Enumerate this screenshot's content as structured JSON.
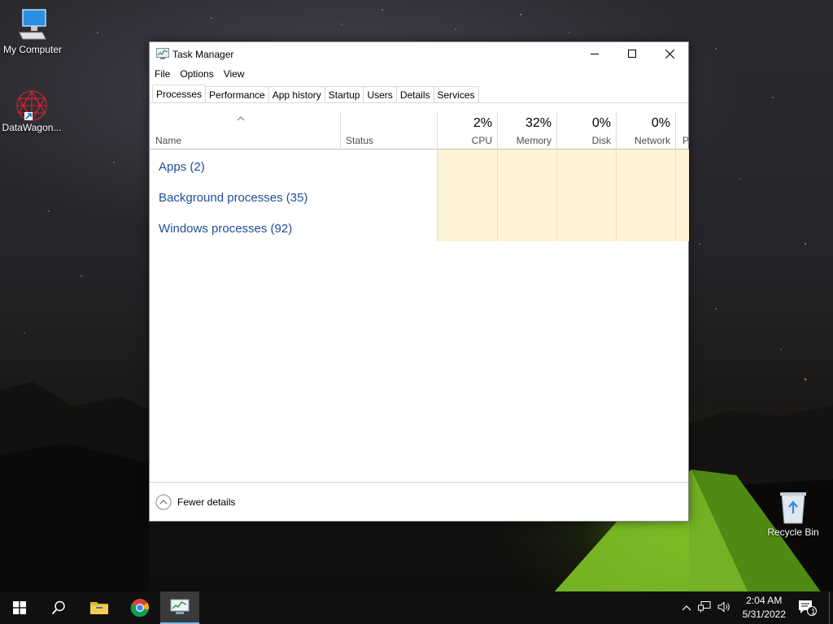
{
  "desktop": {
    "icons": [
      {
        "label": "My Computer"
      },
      {
        "label": "DataWagon..."
      },
      {
        "label": "Recycle Bin"
      }
    ]
  },
  "window": {
    "title": "Task Manager",
    "menu": [
      "File",
      "Options",
      "View"
    ],
    "tabs": [
      "Processes",
      "Performance",
      "App history",
      "Startup",
      "Users",
      "Details",
      "Services"
    ],
    "active_tab": "Processes",
    "columns": {
      "name": "Name",
      "status": "Status",
      "cpu": {
        "label": "CPU",
        "value": "2%"
      },
      "memory": {
        "label": "Memory",
        "value": "32%"
      },
      "disk": {
        "label": "Disk",
        "value": "0%"
      },
      "network": {
        "label": "Network",
        "value": "0%"
      },
      "power": {
        "label": "P"
      }
    },
    "groups": [
      {
        "label": "Apps (2)"
      },
      {
        "label": "Background processes (35)"
      },
      {
        "label": "Windows processes (92)"
      }
    ],
    "footer": {
      "fewer_details": "Fewer details"
    }
  },
  "taskbar": {
    "clock_time": "2:04 AM",
    "clock_date": "5/31/2022",
    "notification_count": "1",
    "accent": "#76b9ed"
  },
  "colors": {
    "group_link": "#1f4e99",
    "heatmap_cell": "#fff4d5"
  }
}
